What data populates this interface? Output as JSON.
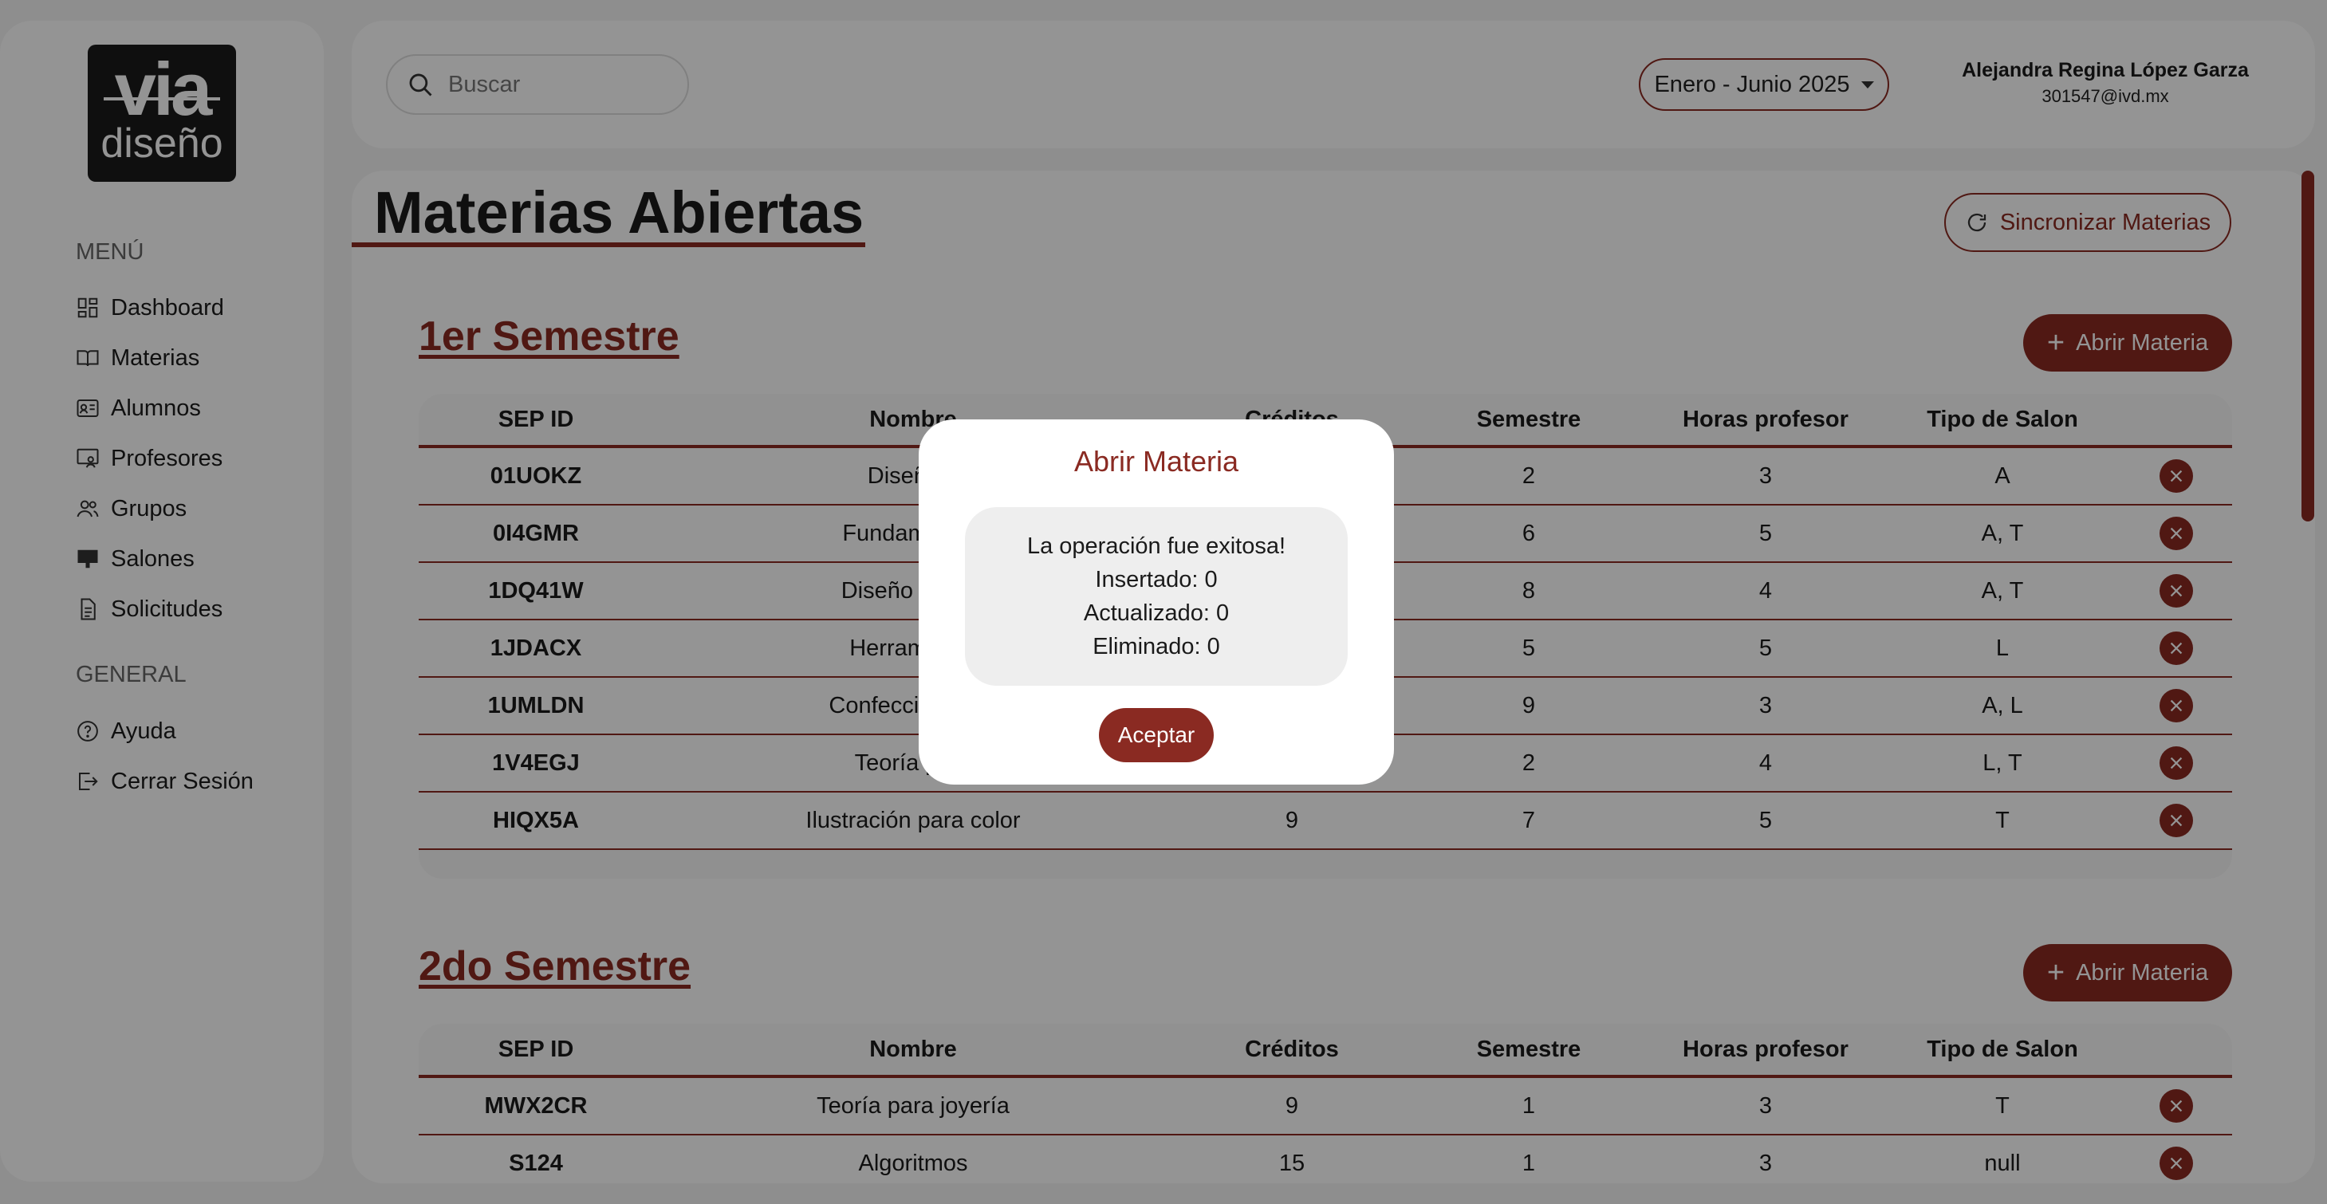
{
  "brand": {
    "logo_top": "via",
    "logo_bottom": "diseño"
  },
  "sidebar": {
    "menu_heading": "MENÚ",
    "items": [
      {
        "label": "Dashboard",
        "icon": "dashboard-icon"
      },
      {
        "label": "Materias",
        "icon": "book-icon"
      },
      {
        "label": "Alumnos",
        "icon": "id-card-icon"
      },
      {
        "label": "Profesores",
        "icon": "teacher-icon"
      },
      {
        "label": "Grupos",
        "icon": "group-icon"
      },
      {
        "label": "Salones",
        "icon": "classroom-icon"
      },
      {
        "label": "Solicitudes",
        "icon": "document-icon"
      }
    ],
    "general_heading": "GENERAL",
    "general_items": [
      {
        "label": "Ayuda",
        "icon": "help-icon"
      },
      {
        "label": "Cerrar Sesión",
        "icon": "logout-icon"
      }
    ]
  },
  "header": {
    "search_placeholder": "Buscar",
    "period": "Enero - Junio 2025",
    "user_name": "Alejandra Regina López Garza",
    "user_email": "301547@ivd.mx"
  },
  "main": {
    "title": "Materias Abiertas",
    "sync_label": "Sincronizar Materias",
    "open_label": "Abrir Materia",
    "columns": [
      "SEP ID",
      "Nombre",
      "Créditos",
      "Semestre",
      "Horas profesor",
      "Tipo de Salon"
    ],
    "semesters": [
      {
        "title": "1er Semestre",
        "rows": [
          {
            "id": "01UOKZ",
            "name": "Diseño d",
            "credits": "",
            "semester": "2",
            "hours": "3",
            "room": "A"
          },
          {
            "id": "0I4GMR",
            "name": "Fundamentos",
            "credits": "",
            "semester": "6",
            "hours": "5",
            "room": "A, T"
          },
          {
            "id": "1DQ41W",
            "name": "Diseño de pre",
            "credits": "",
            "semester": "8",
            "hours": "4",
            "room": "A, T"
          },
          {
            "id": "1JDACX",
            "name": "Herramienta",
            "credits": "",
            "semester": "5",
            "hours": "5",
            "room": "L"
          },
          {
            "id": "1UMLDN",
            "name": "Confección para",
            "credits": "",
            "semester": "9",
            "hours": "3",
            "room": "A, L"
          },
          {
            "id": "1V4EGJ",
            "name": "Teoría para",
            "credits": "",
            "semester": "2",
            "hours": "4",
            "room": "L, T"
          },
          {
            "id": "HIQX5A",
            "name": "Ilustración para color",
            "credits": "9",
            "semester": "7",
            "hours": "5",
            "room": "T"
          }
        ]
      },
      {
        "title": "2do Semestre",
        "rows": [
          {
            "id": "MWX2CR",
            "name": "Teoría para joyería",
            "credits": "9",
            "semester": "1",
            "hours": "3",
            "room": "T"
          },
          {
            "id": "S124",
            "name": "Algoritmos",
            "credits": "15",
            "semester": "1",
            "hours": "3",
            "room": "null"
          }
        ]
      }
    ]
  },
  "modal": {
    "title": "Abrir Materia",
    "message": "La operación fue exitosa!",
    "inserted": "Insertado: 0",
    "updated": "Actualizado: 0",
    "deleted": "Eliminado: 0",
    "accept": "Aceptar"
  },
  "colors": {
    "accent": "#8a2a22",
    "background": "#f5f5f5"
  }
}
